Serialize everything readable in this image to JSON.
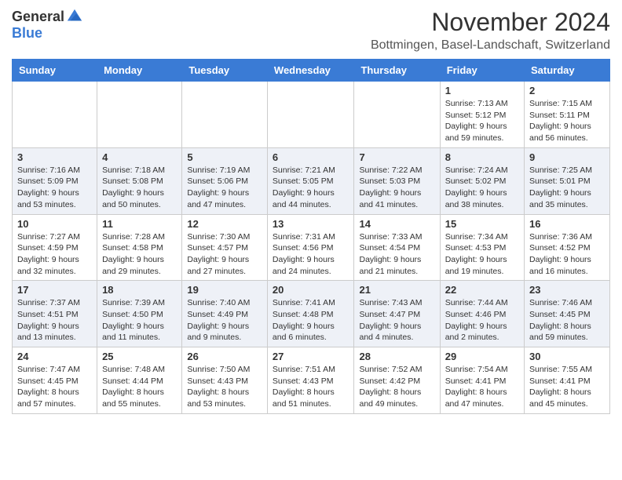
{
  "logo": {
    "general": "General",
    "blue": "Blue"
  },
  "header": {
    "month": "November 2024",
    "location": "Bottmingen, Basel-Landschaft, Switzerland"
  },
  "weekdays": [
    "Sunday",
    "Monday",
    "Tuesday",
    "Wednesday",
    "Thursday",
    "Friday",
    "Saturday"
  ],
  "weeks": [
    [
      {
        "day": "",
        "info": ""
      },
      {
        "day": "",
        "info": ""
      },
      {
        "day": "",
        "info": ""
      },
      {
        "day": "",
        "info": ""
      },
      {
        "day": "",
        "info": ""
      },
      {
        "day": "1",
        "info": "Sunrise: 7:13 AM\nSunset: 5:12 PM\nDaylight: 9 hours and 59 minutes."
      },
      {
        "day": "2",
        "info": "Sunrise: 7:15 AM\nSunset: 5:11 PM\nDaylight: 9 hours and 56 minutes."
      }
    ],
    [
      {
        "day": "3",
        "info": "Sunrise: 7:16 AM\nSunset: 5:09 PM\nDaylight: 9 hours and 53 minutes."
      },
      {
        "day": "4",
        "info": "Sunrise: 7:18 AM\nSunset: 5:08 PM\nDaylight: 9 hours and 50 minutes."
      },
      {
        "day": "5",
        "info": "Sunrise: 7:19 AM\nSunset: 5:06 PM\nDaylight: 9 hours and 47 minutes."
      },
      {
        "day": "6",
        "info": "Sunrise: 7:21 AM\nSunset: 5:05 PM\nDaylight: 9 hours and 44 minutes."
      },
      {
        "day": "7",
        "info": "Sunrise: 7:22 AM\nSunset: 5:03 PM\nDaylight: 9 hours and 41 minutes."
      },
      {
        "day": "8",
        "info": "Sunrise: 7:24 AM\nSunset: 5:02 PM\nDaylight: 9 hours and 38 minutes."
      },
      {
        "day": "9",
        "info": "Sunrise: 7:25 AM\nSunset: 5:01 PM\nDaylight: 9 hours and 35 minutes."
      }
    ],
    [
      {
        "day": "10",
        "info": "Sunrise: 7:27 AM\nSunset: 4:59 PM\nDaylight: 9 hours and 32 minutes."
      },
      {
        "day": "11",
        "info": "Sunrise: 7:28 AM\nSunset: 4:58 PM\nDaylight: 9 hours and 29 minutes."
      },
      {
        "day": "12",
        "info": "Sunrise: 7:30 AM\nSunset: 4:57 PM\nDaylight: 9 hours and 27 minutes."
      },
      {
        "day": "13",
        "info": "Sunrise: 7:31 AM\nSunset: 4:56 PM\nDaylight: 9 hours and 24 minutes."
      },
      {
        "day": "14",
        "info": "Sunrise: 7:33 AM\nSunset: 4:54 PM\nDaylight: 9 hours and 21 minutes."
      },
      {
        "day": "15",
        "info": "Sunrise: 7:34 AM\nSunset: 4:53 PM\nDaylight: 9 hours and 19 minutes."
      },
      {
        "day": "16",
        "info": "Sunrise: 7:36 AM\nSunset: 4:52 PM\nDaylight: 9 hours and 16 minutes."
      }
    ],
    [
      {
        "day": "17",
        "info": "Sunrise: 7:37 AM\nSunset: 4:51 PM\nDaylight: 9 hours and 13 minutes."
      },
      {
        "day": "18",
        "info": "Sunrise: 7:39 AM\nSunset: 4:50 PM\nDaylight: 9 hours and 11 minutes."
      },
      {
        "day": "19",
        "info": "Sunrise: 7:40 AM\nSunset: 4:49 PM\nDaylight: 9 hours and 9 minutes."
      },
      {
        "day": "20",
        "info": "Sunrise: 7:41 AM\nSunset: 4:48 PM\nDaylight: 9 hours and 6 minutes."
      },
      {
        "day": "21",
        "info": "Sunrise: 7:43 AM\nSunset: 4:47 PM\nDaylight: 9 hours and 4 minutes."
      },
      {
        "day": "22",
        "info": "Sunrise: 7:44 AM\nSunset: 4:46 PM\nDaylight: 9 hours and 2 minutes."
      },
      {
        "day": "23",
        "info": "Sunrise: 7:46 AM\nSunset: 4:45 PM\nDaylight: 8 hours and 59 minutes."
      }
    ],
    [
      {
        "day": "24",
        "info": "Sunrise: 7:47 AM\nSunset: 4:45 PM\nDaylight: 8 hours and 57 minutes."
      },
      {
        "day": "25",
        "info": "Sunrise: 7:48 AM\nSunset: 4:44 PM\nDaylight: 8 hours and 55 minutes."
      },
      {
        "day": "26",
        "info": "Sunrise: 7:50 AM\nSunset: 4:43 PM\nDaylight: 8 hours and 53 minutes."
      },
      {
        "day": "27",
        "info": "Sunrise: 7:51 AM\nSunset: 4:43 PM\nDaylight: 8 hours and 51 minutes."
      },
      {
        "day": "28",
        "info": "Sunrise: 7:52 AM\nSunset: 4:42 PM\nDaylight: 8 hours and 49 minutes."
      },
      {
        "day": "29",
        "info": "Sunrise: 7:54 AM\nSunset: 4:41 PM\nDaylight: 8 hours and 47 minutes."
      },
      {
        "day": "30",
        "info": "Sunrise: 7:55 AM\nSunset: 4:41 PM\nDaylight: 8 hours and 45 minutes."
      }
    ]
  ]
}
